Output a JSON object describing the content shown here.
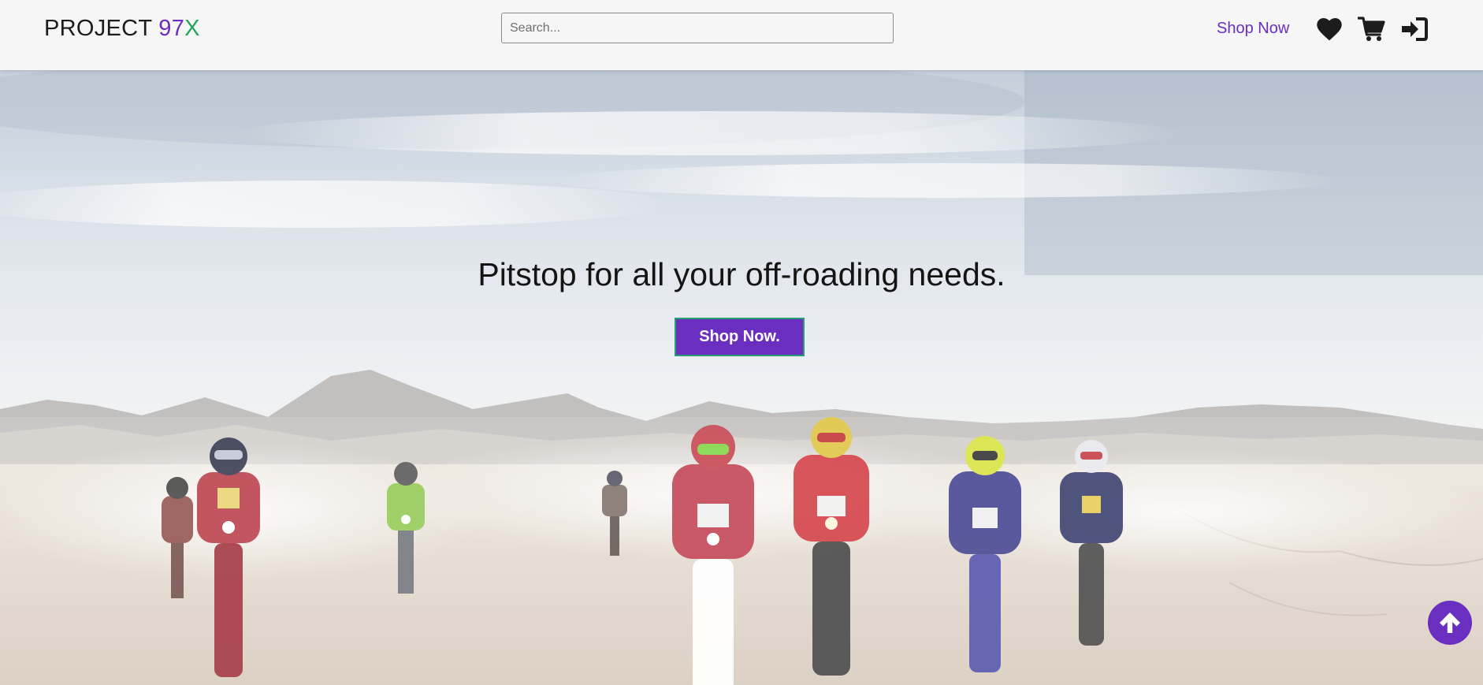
{
  "header": {
    "brand": {
      "word": "PROJECT",
      "number": "97",
      "letter": "X"
    },
    "search": {
      "placeholder": "Search...",
      "value": ""
    },
    "shop_link": "Shop Now",
    "icons": [
      "heart-icon",
      "cart-icon",
      "sign-in-icon"
    ]
  },
  "hero": {
    "title": "Pitstop for all your off-roading needs.",
    "button_label": "Shop Now.",
    "image": "desert-motocross-riders"
  },
  "scroll_top_icon": "arrow-up-circle-icon",
  "colors": {
    "accent": "#6a2ec1",
    "brand_x": "#1fa65a",
    "button_border": "#2a9d77",
    "navbar_bg": "#f6f6f6"
  }
}
